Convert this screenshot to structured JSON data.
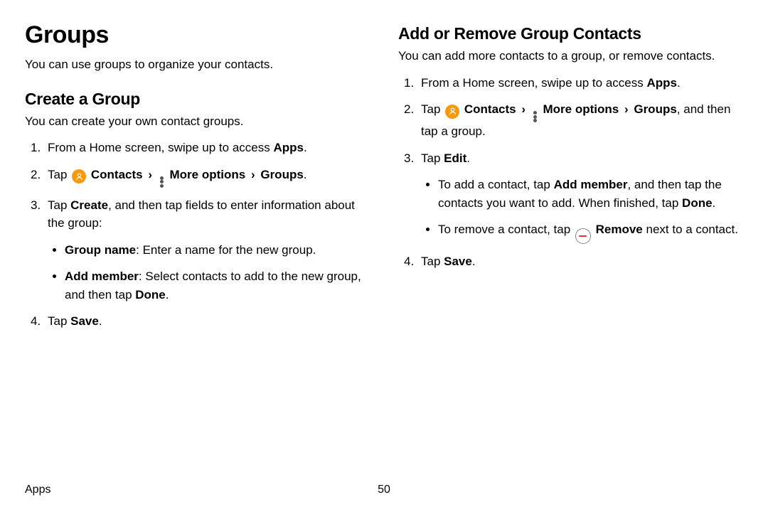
{
  "left": {
    "h1": "Groups",
    "intro": "You can use groups to organize your contacts.",
    "h2": "Create a Group",
    "subintro": "You can create your own contact groups.",
    "step1_pre": "From a Home screen, swipe up to access ",
    "apps": "Apps",
    "step2_tap": "Tap ",
    "contacts": "Contacts",
    "moreoptions": "More options",
    "groups": "Groups",
    "step3a": "Tap ",
    "create": "Create",
    "step3b": ", and then tap fields to enter information about the group:",
    "bullet1_label": "Group name",
    "bullet1_text": ": Enter a name for the new group.",
    "bullet2_label": "Add member",
    "bullet2_text": ": Select contacts to add to the new group, and then tap ",
    "done": "Done",
    "step4_pre": "Tap ",
    "save": "Save"
  },
  "right": {
    "h2": "Add or Remove Group Contacts",
    "intro": "You can add more contacts to a group, or remove contacts.",
    "step1_pre": "From a Home screen, swipe up to access ",
    "apps": "Apps",
    "step2_tap": "Tap ",
    "contacts": "Contacts",
    "moreoptions": "More options",
    "groups": "Groups",
    "step2_tail": ", and then tap a group.",
    "step3_pre": "Tap ",
    "edit": "Edit",
    "bullet1a": "To add a contact, tap ",
    "addmember": "Add member",
    "bullet1b": ", and then tap the contacts you want to add. When finished, tap ",
    "done": "Done",
    "bullet2a": "To remove a contact, tap ",
    "remove": "Remove",
    "bullet2b": " next to a contact.",
    "step4_pre": "Tap ",
    "save": "Save"
  },
  "footer": {
    "section": "Apps",
    "page": "50"
  }
}
